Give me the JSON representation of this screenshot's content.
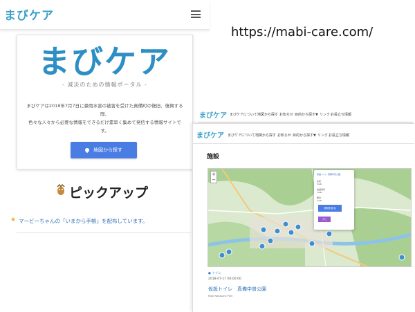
{
  "site_url": "https://mabi-care.com/",
  "phone": {
    "logo": "まびケア",
    "hero_logo": "まびケア",
    "tagline": "- 減災のための情報ポータル -",
    "description": "まびケアは2018年7月7日に豪雨水害の被害を受けた真備町の復旧、復興する間、\n色々な人々から必要な情報をできるだけ素早く集めて発信する情報サイトです。",
    "map_button": "地図から探す",
    "pickup_title": "ピックアップ",
    "pickup_item": "マービーちゃんの「いまから手帳」を配布しています。"
  },
  "desktop": {
    "logo": "まびケア",
    "nav": [
      "まびケアについて",
      "地図から探す",
      "お知らせ",
      "目的から探す▼",
      "リンク",
      "お役立ち情報"
    ],
    "section_heading": "施設",
    "popup": {
      "title": "仮設トイレ 真備中曽公園",
      "fields": [
        "住所",
        "mabi",
        "電話番号",
        "mabi",
        "備考",
        "mabi"
      ],
      "detail_button": "詳細を見る",
      "nav_button": "ナビ"
    },
    "category": "● トイレ",
    "datetime": "2018-07-17 00:00:00",
    "facility_link": "仮設トイレ　真備中曽公園",
    "facility_sub": "Mabi Nakasone Park"
  },
  "colors": {
    "brand_blue": "#2d8fc4",
    "button_blue": "#4a7de4",
    "link_blue": "#2d6fb5"
  }
}
